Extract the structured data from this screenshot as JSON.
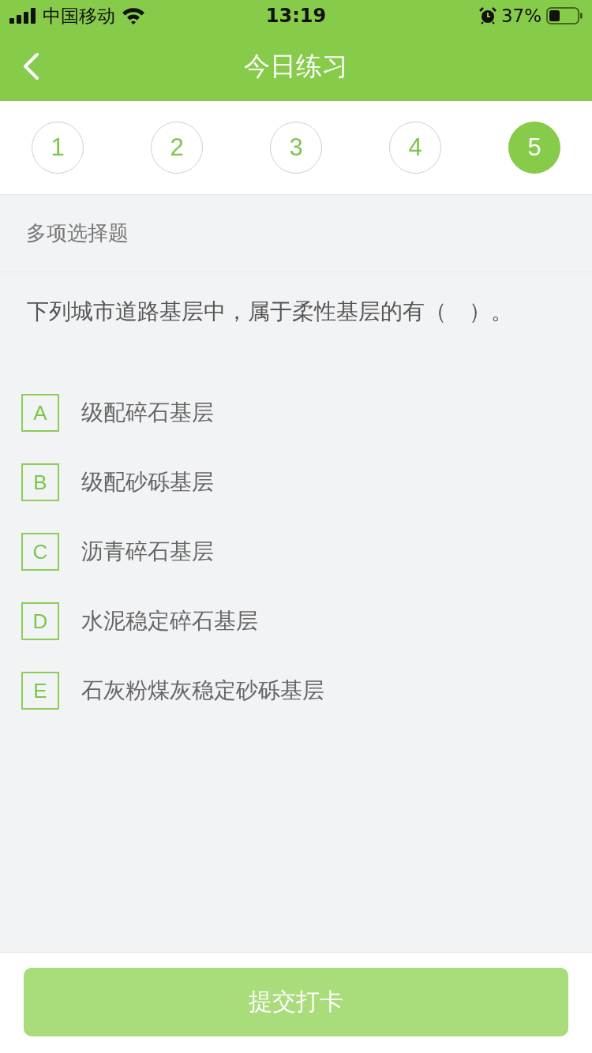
{
  "status_bar": {
    "carrier": "中国移动",
    "time": "13:19",
    "battery": "37%"
  },
  "nav_bar": {
    "title": "今日练习"
  },
  "steps": [
    {
      "label": "1",
      "selected": false
    },
    {
      "label": "2",
      "selected": false
    },
    {
      "label": "3",
      "selected": false
    },
    {
      "label": "4",
      "selected": false
    },
    {
      "label": "5",
      "selected": true
    }
  ],
  "question": {
    "type": "多项选择题",
    "text": "下列城市道路基层中，属于柔性基层的有（　）。",
    "options": [
      {
        "letter": "A",
        "text": "级配碎石基层",
        "selected": false
      },
      {
        "letter": "B",
        "text": "级配砂砾基层",
        "selected": false
      },
      {
        "letter": "C",
        "text": "沥青碎石基层",
        "selected": false
      },
      {
        "letter": "D",
        "text": "水泥稳定碎石基层",
        "selected": false
      },
      {
        "letter": "E",
        "text": "石灰粉煤灰稳定砂砾基层",
        "selected": false
      }
    ]
  },
  "submit_button": {
    "label": "提交打卡",
    "disabled": true
  }
}
